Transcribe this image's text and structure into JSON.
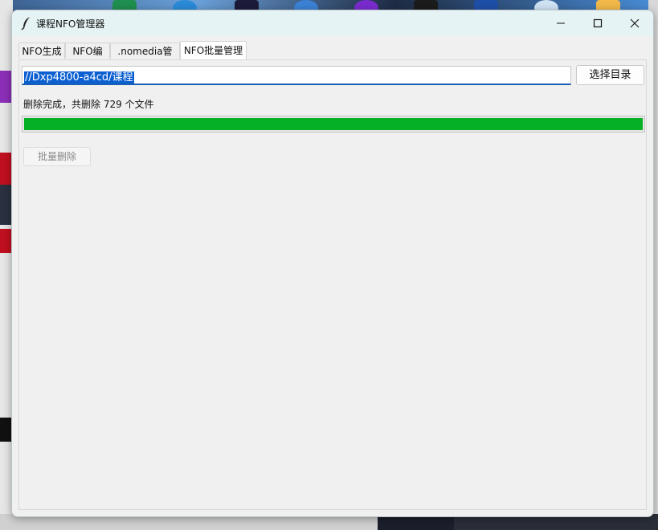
{
  "window": {
    "title": "课程NFO管理器",
    "icons": {
      "app": "feather-icon",
      "minimize": "minimize-icon",
      "maximize": "maximize-icon",
      "close": "close-icon"
    }
  },
  "tabs": [
    {
      "label": "NFO生成",
      "active": false
    },
    {
      "label": "NFO编辑",
      "active": false
    },
    {
      "label": ".nomedia管理",
      "active": false
    },
    {
      "label": "NFO批量管理",
      "active": true
    }
  ],
  "batch": {
    "directory_value": "//Dxp4800-a4cd/课程",
    "choose_dir_label": "选择目录",
    "status_text": "删除完成，共删除 729 个文件",
    "progress_percent": 100,
    "progress_color": "#06b025",
    "batch_delete_label": "批量删除"
  }
}
